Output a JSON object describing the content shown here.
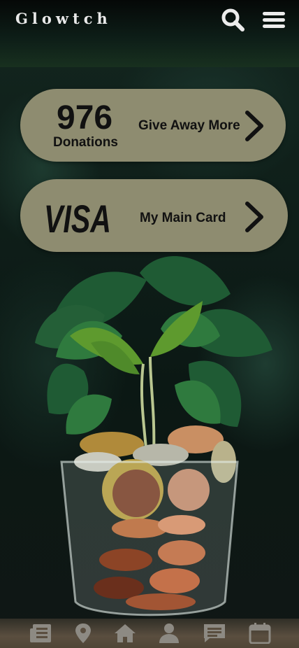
{
  "app": {
    "brand": "Glowtch"
  },
  "header": {
    "search_icon": "search-icon",
    "menu_icon": "menu-icon"
  },
  "donations_card": {
    "count": "976",
    "count_label": "Donations",
    "action_label": "Give Away More",
    "chevron_icon": "chevron-right-icon"
  },
  "payment_card": {
    "card_brand": "VISA",
    "label": "My Main Card",
    "chevron_icon": "chevron-right-icon"
  },
  "bottom_nav": {
    "items": [
      {
        "icon": "newspaper-icon"
      },
      {
        "icon": "location-pin-icon"
      },
      {
        "icon": "home-icon"
      },
      {
        "icon": "person-icon"
      },
      {
        "icon": "chat-icon"
      },
      {
        "icon": "calendar-icon"
      }
    ]
  },
  "colors": {
    "card_bg": "#8e8c70",
    "card_text": "#111111",
    "nav_icon": "#8d8a83",
    "nav_bg": "#5a4e3f"
  }
}
